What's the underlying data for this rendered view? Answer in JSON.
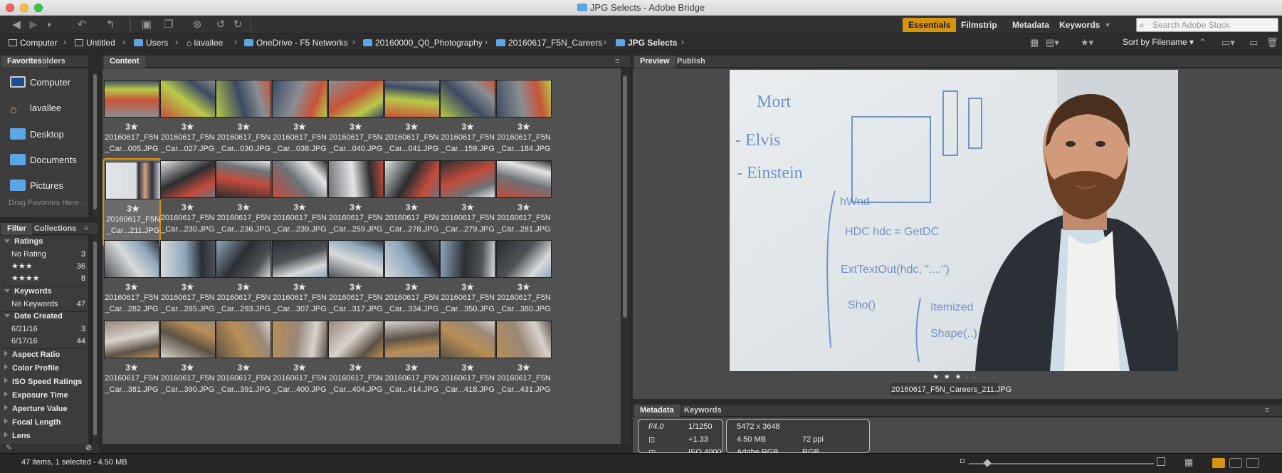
{
  "window": {
    "title": "JPG Selects - Adobe Bridge"
  },
  "workspaces": [
    "Essentials",
    "Filmstrip",
    "Metadata",
    "Keywords"
  ],
  "search": {
    "placeholder": "Search Adobe Stock"
  },
  "breadcrumb": [
    "Computer",
    "Untitled",
    "Users",
    "lavallee",
    "OneDrive - F5 Networks",
    "20160000_Q0_Photography",
    "20160617_F5N_Careers",
    "JPG Selects"
  ],
  "sort": {
    "label": "Sort by Filename"
  },
  "panels": {
    "favorites_tabs": [
      "Favorites",
      "Folders"
    ],
    "content_tab": "Content",
    "preview_tabs": [
      "Preview",
      "Publish"
    ],
    "filter_tabs": [
      "Filter",
      "Collections"
    ],
    "metadata_tabs": [
      "Metadata",
      "Keywords"
    ]
  },
  "favorites": {
    "items": [
      {
        "label": "Computer",
        "icon": "computer-icon"
      },
      {
        "label": "lavallee",
        "icon": "home-icon"
      },
      {
        "label": "Desktop",
        "icon": "folder-icon"
      },
      {
        "label": "Documents",
        "icon": "folder-icon"
      },
      {
        "label": "Pictures",
        "icon": "folder-icon"
      }
    ],
    "hint": "Drag Favorites Here..."
  },
  "filter": {
    "ratings_title": "Ratings",
    "ratings": [
      {
        "label": "No Rating",
        "count": "3"
      },
      {
        "label": "★★★",
        "count": "36"
      },
      {
        "label": "★★★★",
        "count": "8"
      }
    ],
    "keywords_title": "Keywords",
    "keywords": [
      {
        "label": "No Keywords",
        "count": "47"
      }
    ],
    "date_title": "Date Created",
    "dates": [
      {
        "label": "6/21/16",
        "count": "3"
      },
      {
        "label": "6/17/16",
        "count": "44"
      }
    ],
    "collapsed": [
      "Aspect Ratio",
      "Color Profile",
      "ISO Speed Ratings",
      "Exposure Time",
      "Aperture Value",
      "Focal Length",
      "Lens"
    ]
  },
  "thumbnails": [
    {
      "stars": "3★",
      "name1": "20160617_F5N",
      "name2": "_Car...005.JPG"
    },
    {
      "stars": "3★",
      "name1": "20160617_F5N",
      "name2": "_Car...027.JPG"
    },
    {
      "stars": "3★",
      "name1": "20160617_F5N",
      "name2": "_Car...030.JPG"
    },
    {
      "stars": "3★",
      "name1": "20160617_F5N",
      "name2": "_Car...038.JPG"
    },
    {
      "stars": "3★",
      "name1": "20160617_F5N",
      "name2": "_Car...040.JPG"
    },
    {
      "stars": "3★",
      "name1": "20160617_F5N",
      "name2": "_Car...041.JPG"
    },
    {
      "stars": "3★",
      "name1": "20160617_F5N",
      "name2": "_Car...159.JPG"
    },
    {
      "stars": "3★",
      "name1": "20160617_F5N",
      "name2": "_Car...184.JPG"
    },
    {
      "stars": "3★",
      "name1": "20160617_F5N",
      "name2": "_Car...211.JPG"
    },
    {
      "stars": "3★",
      "name1": "20160617_F5N",
      "name2": "_Car...230.JPG"
    },
    {
      "stars": "3★",
      "name1": "20160617_F5N",
      "name2": "_Car...236.JPG"
    },
    {
      "stars": "3★",
      "name1": "20160617_F5N",
      "name2": "_Car...239.JPG"
    },
    {
      "stars": "3★",
      "name1": "20160617_F5N",
      "name2": "_Car...259.JPG"
    },
    {
      "stars": "3★",
      "name1": "20160617_F5N",
      "name2": "_Car...278.JPG"
    },
    {
      "stars": "3★",
      "name1": "20160617_F5N",
      "name2": "_Car...279.JPG"
    },
    {
      "stars": "3★",
      "name1": "20160617_F5N",
      "name2": "_Car...281.JPG"
    },
    {
      "stars": "3★",
      "name1": "20160617_F5N",
      "name2": "_Car...282.JPG"
    },
    {
      "stars": "3★",
      "name1": "20160617_F5N",
      "name2": "_Car...285.JPG"
    },
    {
      "stars": "3★",
      "name1": "20160617_F5N",
      "name2": "_Car...293.JPG"
    },
    {
      "stars": "3★",
      "name1": "20160617_F5N",
      "name2": "_Car...307.JPG"
    },
    {
      "stars": "3★",
      "name1": "20160617_F5N",
      "name2": "_Car...317.JPG"
    },
    {
      "stars": "3★",
      "name1": "20160617_F5N",
      "name2": "_Car...334.JPG"
    },
    {
      "stars": "3★",
      "name1": "20160617_F5N",
      "name2": "_Car...350.JPG"
    },
    {
      "stars": "3★",
      "name1": "20160617_F5N",
      "name2": "_Car...380.JPG"
    },
    {
      "stars": "3★",
      "name1": "20160617_F5N",
      "name2": "_Car...381.JPG"
    },
    {
      "stars": "3★",
      "name1": "20160617_F5N",
      "name2": "_Car...390.JPG"
    },
    {
      "stars": "3★",
      "name1": "20160617_F5N",
      "name2": "_Car...391.JPG"
    },
    {
      "stars": "3★",
      "name1": "20160617_F5N",
      "name2": "_Car...400.JPG"
    },
    {
      "stars": "3★",
      "name1": "20160617_F5N",
      "name2": "_Car...404.JPG"
    },
    {
      "stars": "3★",
      "name1": "20160617_F5N",
      "name2": "_Car...414.JPG"
    },
    {
      "stars": "3★",
      "name1": "20160617_F5N",
      "name2": "_Car...418.JPG"
    },
    {
      "stars": "3★",
      "name1": "20160617_F5N",
      "name2": "_Car...431.JPG"
    }
  ],
  "selected_index": 8,
  "preview": {
    "filename": "20160617_F5N_Careers_211.JPG",
    "stars": "★ ★ ★ · ·",
    "whiteboard": [
      "Mort",
      "- Elvis",
      "- Einstein",
      "hWnd",
      "HDC hdc = GetDC",
      "ExtTextOut(hdc, \"....\")",
      "Sho()",
      "Itemized",
      "Shape(..)"
    ]
  },
  "metadata": {
    "aperture": "f/4.0",
    "shutter": "1/1250",
    "exposure_comp": "+1.33",
    "iso": "ISO 4000",
    "dimensions": "5472 x 3648",
    "file_size": "4.50 MB",
    "resolution": "72 ppi",
    "color_profile": "Adobe RGB",
    "color_mode": "RGB"
  },
  "status": {
    "text": "47 items, 1 selected - 4.50 MB"
  },
  "colors": {
    "accent": "#d59511",
    "folder": "#5ba6e6",
    "panel": "#515151"
  }
}
